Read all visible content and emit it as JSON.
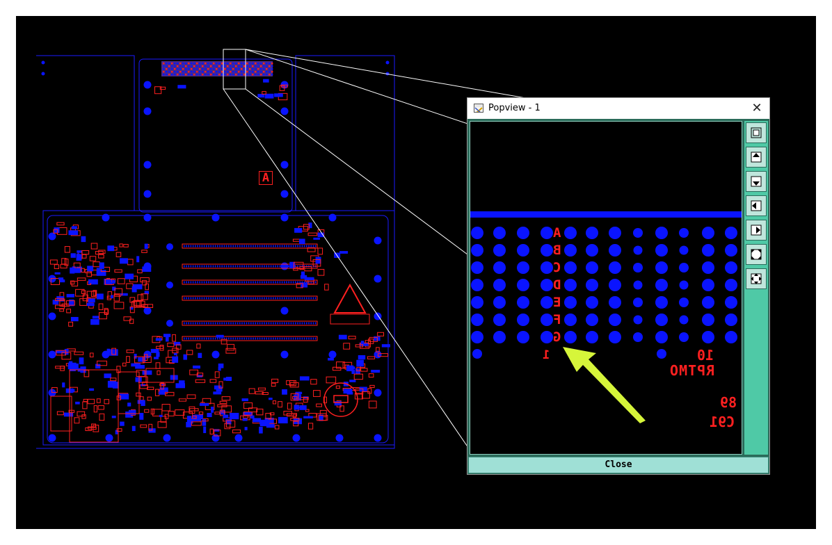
{
  "colors": {
    "background": "#000000",
    "copper_pads": "#0a14ff",
    "silk": "#ff2020",
    "outline": "#1a1aff",
    "arrow": "#d6f53a",
    "toolbar": "#4fc9a6",
    "close_button": "#9fe0d6"
  },
  "popview": {
    "title": "Popview - 1",
    "close_button_label": "Close",
    "toolbar_icons": [
      "zoom-fit-icon",
      "pan-up-icon",
      "pan-down-icon",
      "pan-left-icon",
      "pan-right-icon",
      "zoom-out-icon",
      "zoom-in-icon"
    ],
    "row_letters": [
      "A",
      "B",
      "C",
      "D",
      "E",
      "F",
      "G"
    ],
    "pin_one_label": "1",
    "ref_number": "10",
    "ref_name": "RPTMO",
    "part_number": "89",
    "part_ref": "C91"
  },
  "board": {
    "assembly_marker": "A"
  }
}
